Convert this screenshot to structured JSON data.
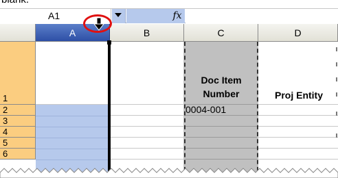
{
  "top_text": "blank.",
  "formula_bar": {
    "name_box_value": "A1",
    "fx_label": "fx",
    "formula_value": ""
  },
  "columns": [
    {
      "id": "a",
      "label": "A",
      "selected": true
    },
    {
      "id": "b",
      "label": "B"
    },
    {
      "id": "c",
      "label": "C"
    },
    {
      "id": "d",
      "label": "D"
    }
  ],
  "rows": [
    "1",
    "2",
    "3",
    "4",
    "5",
    "6"
  ],
  "cells": {
    "C1": "Doc Item Number",
    "D1": "Proj Entity",
    "C2": "0004-001"
  },
  "colors": {
    "selected_column_header": "#3c5fb5",
    "selected_column_fill": "#b6c9ec",
    "row_header_fill": "#fbcd80",
    "copied_column_fill": "#c0c0c0",
    "highlight_circle": "#e01010"
  },
  "icons": {
    "cursor": "column-resize-down-arrow-icon",
    "name_box_dropdown": "dropdown-arrow-icon",
    "formula": "fx-icon"
  }
}
